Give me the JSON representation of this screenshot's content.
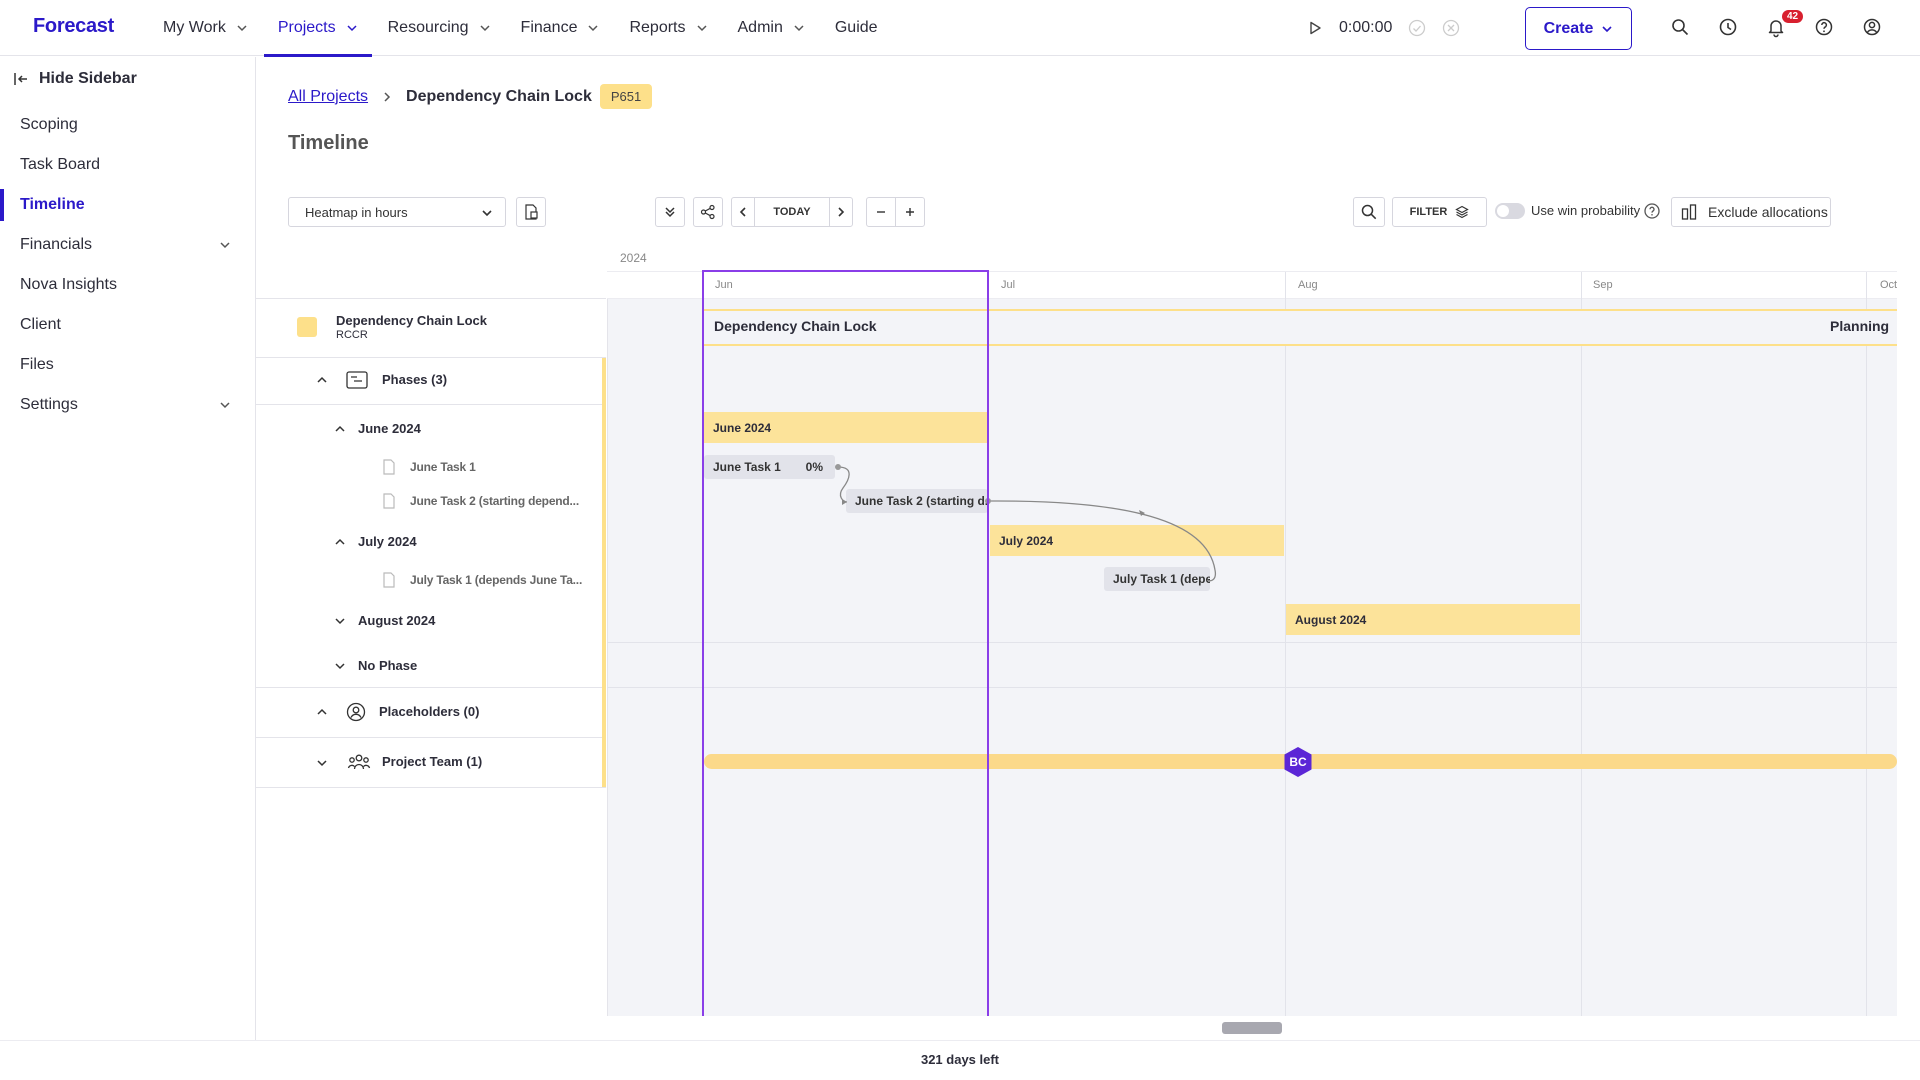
{
  "app": {
    "logo": "Forecast"
  },
  "nav": {
    "items": [
      {
        "label": "My Work",
        "has_menu": true
      },
      {
        "label": "Projects",
        "has_menu": true,
        "active": true
      },
      {
        "label": "Resourcing",
        "has_menu": true
      },
      {
        "label": "Finance",
        "has_menu": true
      },
      {
        "label": "Reports",
        "has_menu": true
      },
      {
        "label": "Admin",
        "has_menu": true
      },
      {
        "label": "Guide",
        "has_menu": false
      }
    ],
    "timer": "0:00:00",
    "create_label": "Create",
    "notification_count": "42"
  },
  "sidebar": {
    "hide_label": "Hide Sidebar",
    "items": [
      {
        "label": "Scoping"
      },
      {
        "label": "Task Board"
      },
      {
        "label": "Timeline",
        "active": true
      },
      {
        "label": "Financials",
        "expandable": true
      },
      {
        "label": "Nova Insights"
      },
      {
        "label": "Client"
      },
      {
        "label": "Files"
      },
      {
        "label": "Settings",
        "expandable": true
      }
    ]
  },
  "header": {
    "breadcrumb_root": "All Projects",
    "breadcrumb_current": "Dependency Chain Lock",
    "project_badge": "P651",
    "title": "Timeline"
  },
  "toolbar": {
    "heatmap_value": "Heatmap in hours",
    "today_label": "TODAY",
    "filter_label": "FILTER",
    "win_probability_label": "Use win probability",
    "win_probability_enabled": false,
    "exclude_label": "Exclude allocations"
  },
  "rows": {
    "project_name": "Dependency Chain Lock",
    "project_client": "RCCR",
    "phases_header": "Phases (3)",
    "phase_june": "June 2024",
    "task_june_1": "June Task 1",
    "task_june_2": "June Task 2 (starting depend...",
    "phase_july": "July 2024",
    "task_july_1": "July Task 1 (depends June Ta...",
    "phase_august": "August 2024",
    "no_phase": "No Phase",
    "placeholders": "Placeholders (0)",
    "project_team": "Project Team (1)"
  },
  "timeline": {
    "year": "2024",
    "months": [
      "Jun",
      "Jul",
      "Aug",
      "Sep",
      "Oct"
    ],
    "project_bar_label": "Dependency Chain Lock",
    "project_status": "Planning",
    "bar_june": "June 2024",
    "bar_june_task1": "June Task 1",
    "bar_june_task1_progress": "0%",
    "bar_june_task2": "June Task 2 (starting d...",
    "bar_july": "July 2024",
    "bar_july_task1": "July Task 1 (depe...",
    "bar_august": "August 2024",
    "team_avatar": "BC",
    "accent_color": "#8a3ee8",
    "phase_color": "#fce39a"
  },
  "footer": {
    "days_left": "321 days left"
  }
}
